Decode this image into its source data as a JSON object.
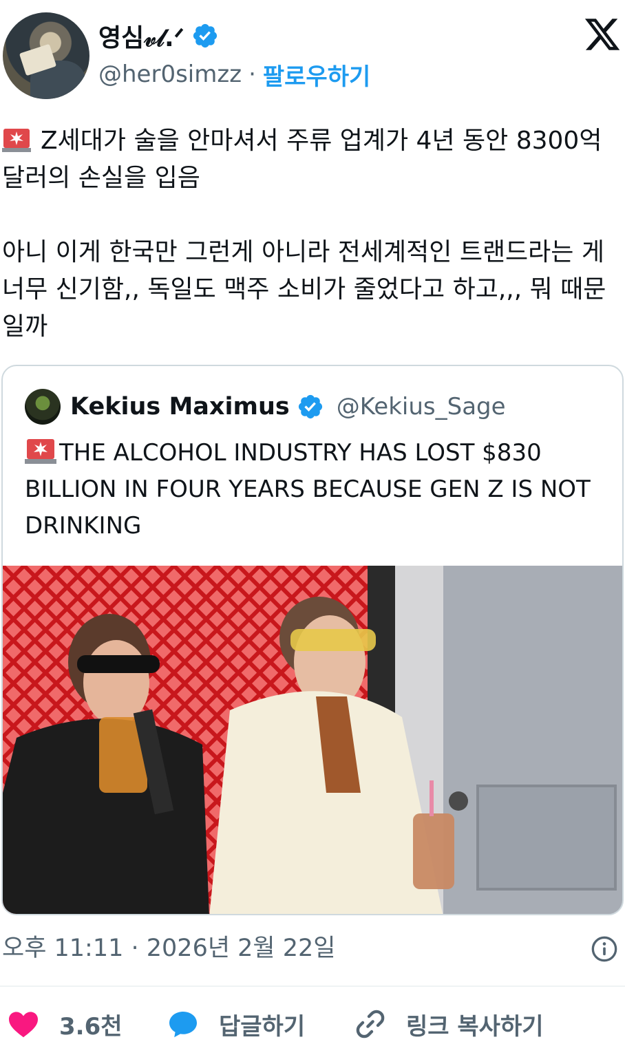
{
  "author": {
    "display_name": "영심𝓋𝓁.ᐟ",
    "handle": "@her0simzz",
    "separator": "·",
    "follow_label": "팔로우하기"
  },
  "tweet": {
    "text_line1": "Z세대가 술을 안마셔서 주류 업계가 4년 동안 8300억 달러의 손실을 입음",
    "text_line2": "아니 이게 한국만 그런게 아니라 전세계적인 트랜드라는 게 너무 신기함,, 독일도 맥주 소비가 줄었다고 하고,,, 뭐 때문일까"
  },
  "quote": {
    "display_name": "Kekius Maximus",
    "handle": "@Kekius_Sage",
    "text": "THE ALCOHOL INDUSTRY HAS LOST $830 BILLION IN FOUR YEARS BECAUSE GEN Z IS NOT DRINKING"
  },
  "meta": {
    "timestamp": "오후 11:11 · 2026년 2월 22일"
  },
  "actions": {
    "like_count": "3.6천",
    "reply_label": "답글하기",
    "copy_link_label": "링크 복사하기"
  },
  "colors": {
    "accent": "#1d9bf0",
    "secondary_text": "#536471",
    "like": "#f91880",
    "border": "#cfd9de"
  },
  "icons": [
    "verified-badge-icon",
    "x-logo-icon",
    "siren-emoji-icon",
    "info-icon",
    "heart-icon",
    "reply-bubble-icon",
    "link-icon"
  ]
}
